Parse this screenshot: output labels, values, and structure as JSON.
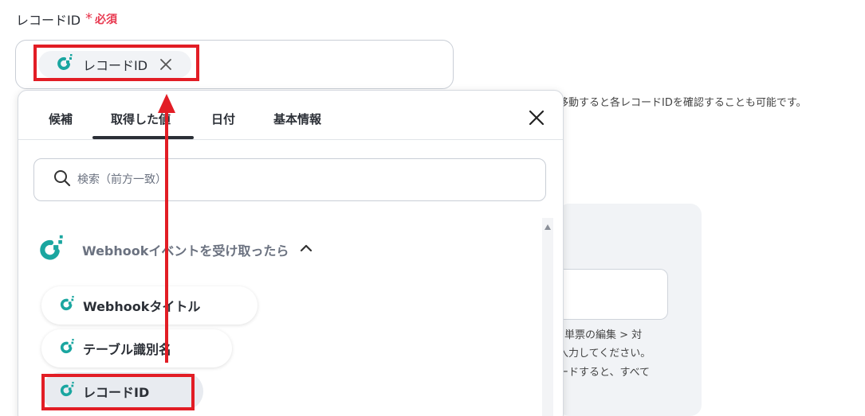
{
  "field": {
    "label": "レコードID",
    "required_mark": "*",
    "required_text": "必須",
    "token_label": "レコードID"
  },
  "hint": "移動すると各レコードIDを確認することも可能です。",
  "background_notes": [
    "単票の編集 > 対",
    "入力してください。",
    "ードすると、すべて"
  ],
  "popup": {
    "tabs": [
      "候補",
      "取得した値",
      "日付",
      "基本情報"
    ],
    "active_tab": "取得した値",
    "search_placeholder": "検索（前方一致）",
    "group_title": "Webhookイベントを受け取ったら",
    "items": [
      "Webhookタイトル",
      "テーブル識別名",
      "レコードID"
    ],
    "selected_item": "レコードID"
  },
  "colors": {
    "accent_red": "#e21d25",
    "required_red": "#e8384f",
    "logo_teal": "#1aa6a0"
  },
  "icons": [
    "app-logo-icon",
    "close-icon",
    "search-icon",
    "chevron-up-icon"
  ]
}
